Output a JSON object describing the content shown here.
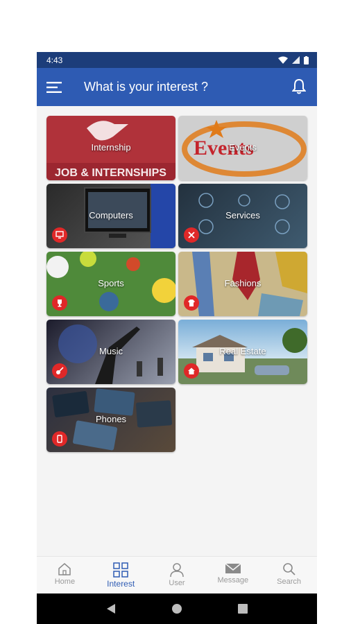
{
  "status": {
    "time": "4:43"
  },
  "appbar": {
    "title": "What is your interest ?"
  },
  "categories": [
    {
      "label": "Internship",
      "banner_text": "JOB & INTERNSHIPS",
      "icon": "briefcase-icon"
    },
    {
      "label": "Events",
      "banner_text": "Events",
      "icon": "star-icon"
    },
    {
      "label": "Computers",
      "icon": "monitor-icon"
    },
    {
      "label": "Services",
      "icon": "tools-icon"
    },
    {
      "label": "Sports",
      "icon": "trophy-icon"
    },
    {
      "label": "Fashions",
      "icon": "shirt-icon"
    },
    {
      "label": "Music",
      "icon": "guitar-icon"
    },
    {
      "label": "Real Estate",
      "icon": "house-icon"
    },
    {
      "label": "Phones",
      "icon": "phone-icon"
    }
  ],
  "bottom_nav": [
    {
      "label": "Home",
      "icon": "home-icon"
    },
    {
      "label": "Interest",
      "icon": "grid-icon",
      "active": true
    },
    {
      "label": "User",
      "icon": "user-icon"
    },
    {
      "label": "Message",
      "icon": "envelope-icon"
    },
    {
      "label": "Search",
      "icon": "search-icon"
    }
  ],
  "colors": {
    "statusbar": "#1c3d7a",
    "appbar": "#2e5bb3",
    "badge": "#e02828",
    "active_nav": "#2e5bb3"
  }
}
